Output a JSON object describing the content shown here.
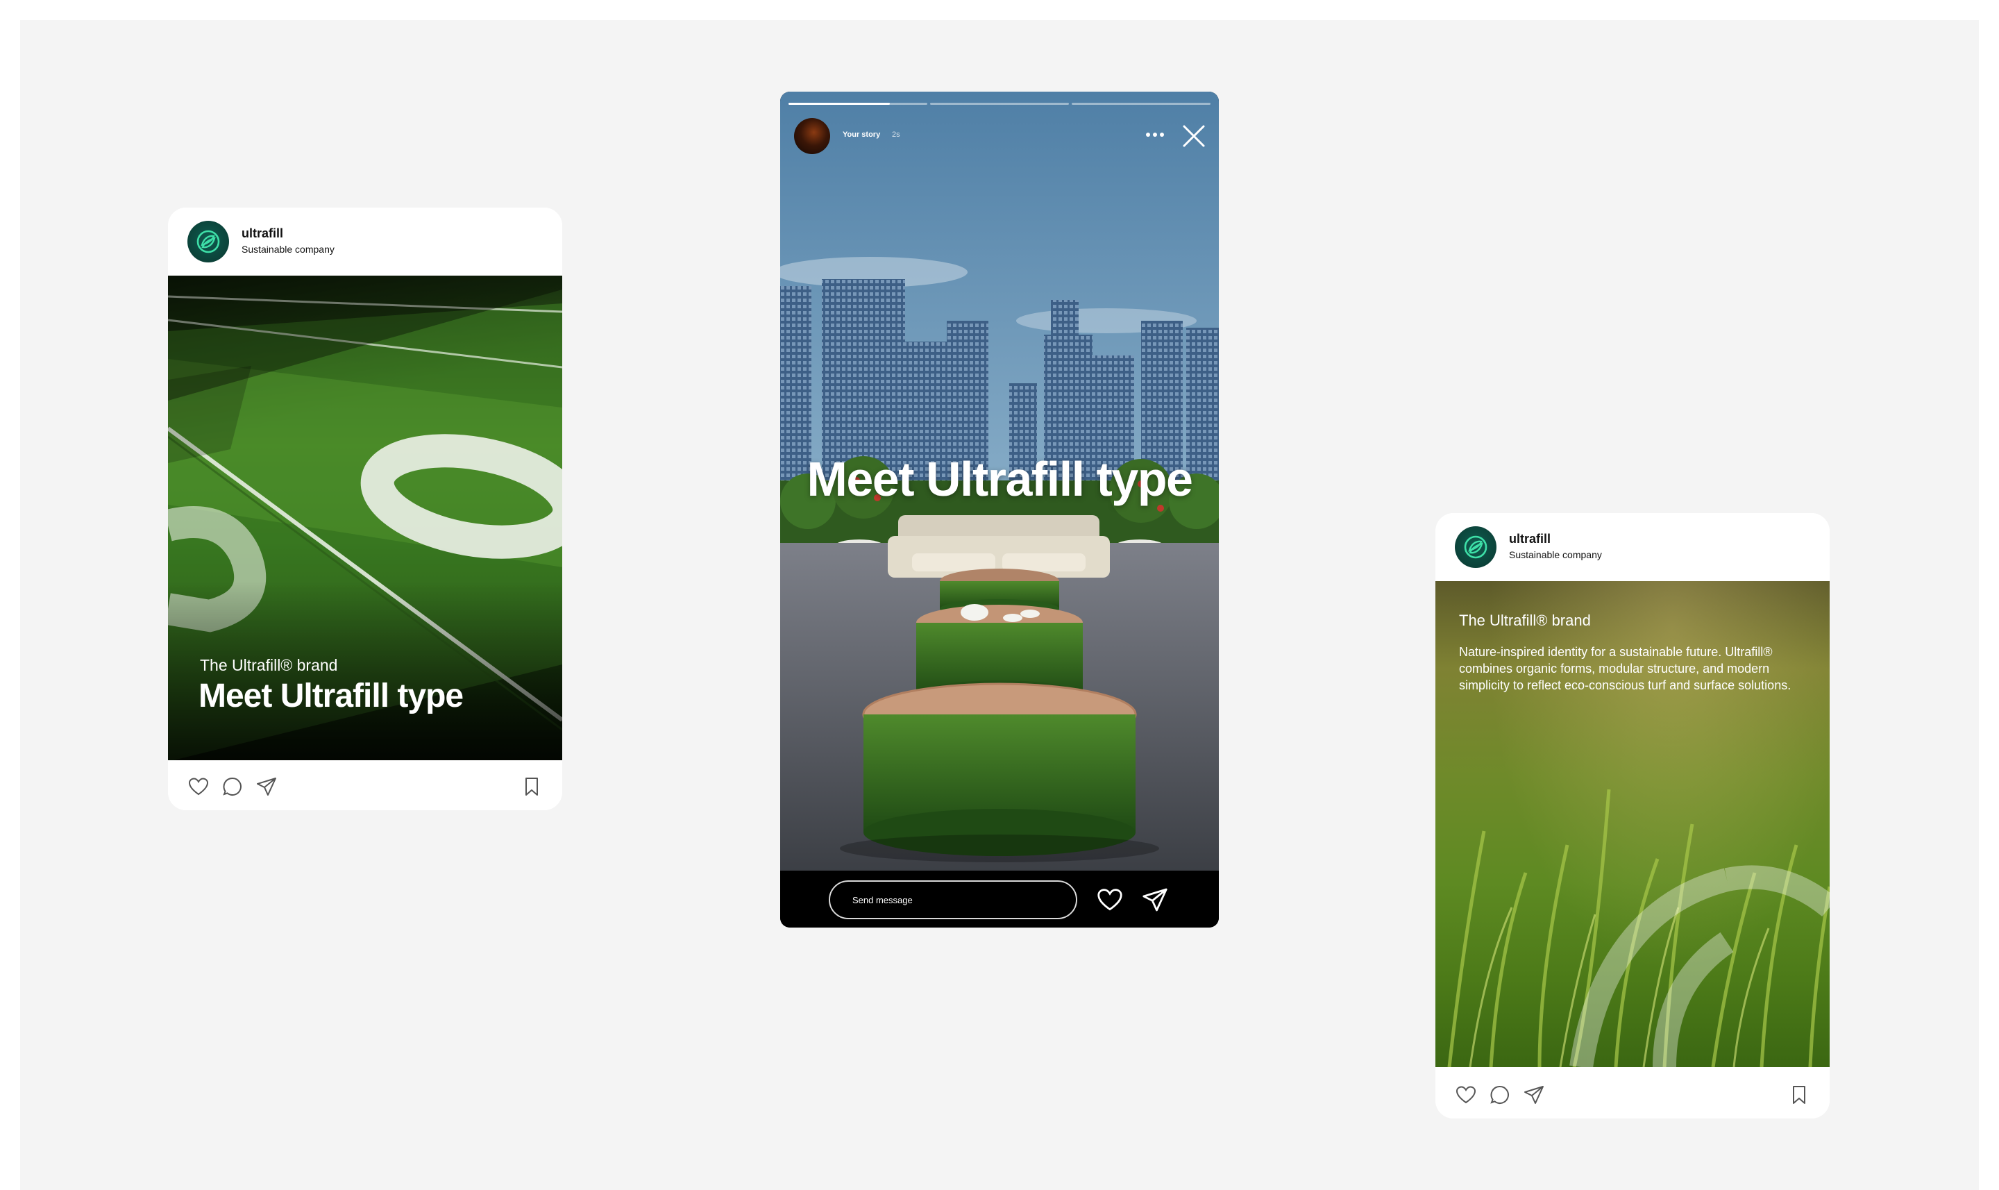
{
  "account": {
    "name": "ultrafill",
    "subtitle": "Sustainable company"
  },
  "left_post": {
    "kicker": "The Ultrafill® brand",
    "title": "Meet Ultrafill type"
  },
  "story": {
    "user": "Your story",
    "time": "2s",
    "title": "Meet Ultrafill type",
    "message_placeholder": "Send message",
    "progress": [
      0.73,
      0,
      0
    ]
  },
  "right_post": {
    "kicker": "The Ultrafill® brand",
    "body": "Nature-inspired identity for a sustainable future. Ultrafill® combines organic forms, modular structure, and modern simplicity to reflect eco-conscious turf and surface solutions."
  },
  "colors": {
    "canvas": "#f4f4f4",
    "brand_dark": "#0b4239",
    "brand_accent": "#3ee0a8"
  },
  "icons": [
    "ultrafill-logo-icon",
    "heart-icon",
    "comment-icon",
    "share-icon",
    "bookmark-icon",
    "more-icon",
    "close-icon",
    "send-icon"
  ]
}
